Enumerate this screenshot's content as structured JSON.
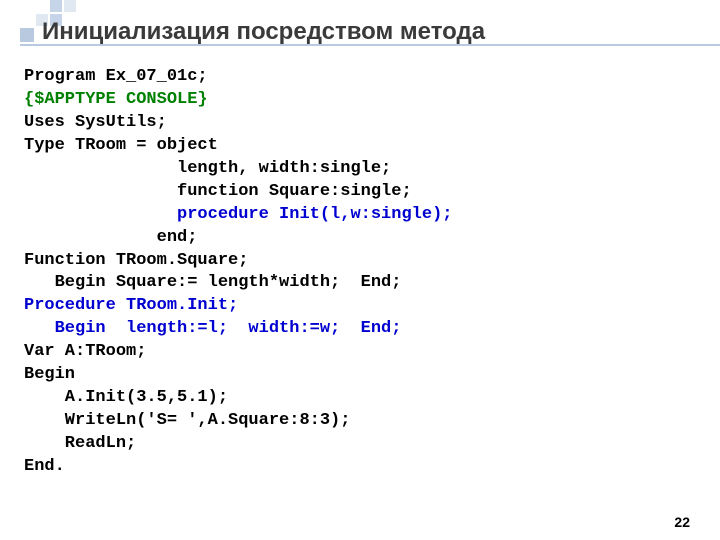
{
  "heading": "Инициализация посредством метода",
  "code": {
    "l1": "Program Ex_07_01c;",
    "l2": "{$APPTYPE CONSOLE}",
    "l3": "Uses SysUtils;",
    "l4": "Type TRoom = object",
    "l5": "               length, width:single;",
    "l6": "               function Square:single;",
    "l7": "               procedure Init(l,w:single);",
    "l8": "             end;",
    "l9": "Function TRoom.Square;",
    "l10": "   Begin Square:= length*width;  End;",
    "l11": "Procedure TRoom.Init;",
    "l12": "   Begin  length:=l;  width:=w;  End;",
    "l13": "Var A:TRoom;",
    "l14": "Begin",
    "l15": "    A.Init(3.5,5.1);",
    "l16": "    WriteLn('S= ',A.Square:8:3);",
    "l17": "    ReadLn;",
    "l18": "End."
  },
  "page_number": "22"
}
